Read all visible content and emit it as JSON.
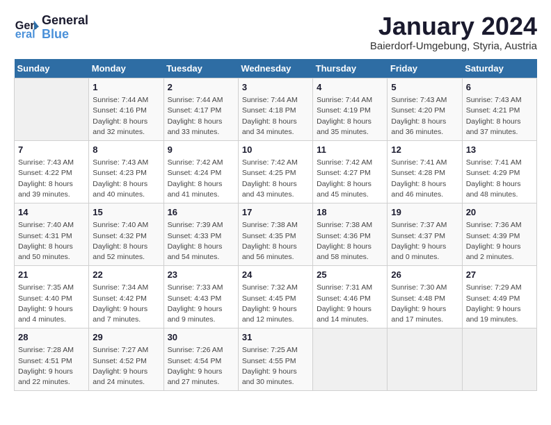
{
  "logo": {
    "line1": "General",
    "line2": "Blue"
  },
  "title": "January 2024",
  "subtitle": "Baierdorf-Umgebung, Styria, Austria",
  "days_of_week": [
    "Sunday",
    "Monday",
    "Tuesday",
    "Wednesday",
    "Thursday",
    "Friday",
    "Saturday"
  ],
  "weeks": [
    [
      {
        "day": "",
        "info": ""
      },
      {
        "day": "1",
        "info": "Sunrise: 7:44 AM\nSunset: 4:16 PM\nDaylight: 8 hours\nand 32 minutes."
      },
      {
        "day": "2",
        "info": "Sunrise: 7:44 AM\nSunset: 4:17 PM\nDaylight: 8 hours\nand 33 minutes."
      },
      {
        "day": "3",
        "info": "Sunrise: 7:44 AM\nSunset: 4:18 PM\nDaylight: 8 hours\nand 34 minutes."
      },
      {
        "day": "4",
        "info": "Sunrise: 7:44 AM\nSunset: 4:19 PM\nDaylight: 8 hours\nand 35 minutes."
      },
      {
        "day": "5",
        "info": "Sunrise: 7:43 AM\nSunset: 4:20 PM\nDaylight: 8 hours\nand 36 minutes."
      },
      {
        "day": "6",
        "info": "Sunrise: 7:43 AM\nSunset: 4:21 PM\nDaylight: 8 hours\nand 37 minutes."
      }
    ],
    [
      {
        "day": "7",
        "info": "Sunrise: 7:43 AM\nSunset: 4:22 PM\nDaylight: 8 hours\nand 39 minutes."
      },
      {
        "day": "8",
        "info": "Sunrise: 7:43 AM\nSunset: 4:23 PM\nDaylight: 8 hours\nand 40 minutes."
      },
      {
        "day": "9",
        "info": "Sunrise: 7:42 AM\nSunset: 4:24 PM\nDaylight: 8 hours\nand 41 minutes."
      },
      {
        "day": "10",
        "info": "Sunrise: 7:42 AM\nSunset: 4:25 PM\nDaylight: 8 hours\nand 43 minutes."
      },
      {
        "day": "11",
        "info": "Sunrise: 7:42 AM\nSunset: 4:27 PM\nDaylight: 8 hours\nand 45 minutes."
      },
      {
        "day": "12",
        "info": "Sunrise: 7:41 AM\nSunset: 4:28 PM\nDaylight: 8 hours\nand 46 minutes."
      },
      {
        "day": "13",
        "info": "Sunrise: 7:41 AM\nSunset: 4:29 PM\nDaylight: 8 hours\nand 48 minutes."
      }
    ],
    [
      {
        "day": "14",
        "info": "Sunrise: 7:40 AM\nSunset: 4:31 PM\nDaylight: 8 hours\nand 50 minutes."
      },
      {
        "day": "15",
        "info": "Sunrise: 7:40 AM\nSunset: 4:32 PM\nDaylight: 8 hours\nand 52 minutes."
      },
      {
        "day": "16",
        "info": "Sunrise: 7:39 AM\nSunset: 4:33 PM\nDaylight: 8 hours\nand 54 minutes."
      },
      {
        "day": "17",
        "info": "Sunrise: 7:38 AM\nSunset: 4:35 PM\nDaylight: 8 hours\nand 56 minutes."
      },
      {
        "day": "18",
        "info": "Sunrise: 7:38 AM\nSunset: 4:36 PM\nDaylight: 8 hours\nand 58 minutes."
      },
      {
        "day": "19",
        "info": "Sunrise: 7:37 AM\nSunset: 4:37 PM\nDaylight: 9 hours\nand 0 minutes."
      },
      {
        "day": "20",
        "info": "Sunrise: 7:36 AM\nSunset: 4:39 PM\nDaylight: 9 hours\nand 2 minutes."
      }
    ],
    [
      {
        "day": "21",
        "info": "Sunrise: 7:35 AM\nSunset: 4:40 PM\nDaylight: 9 hours\nand 4 minutes."
      },
      {
        "day": "22",
        "info": "Sunrise: 7:34 AM\nSunset: 4:42 PM\nDaylight: 9 hours\nand 7 minutes."
      },
      {
        "day": "23",
        "info": "Sunrise: 7:33 AM\nSunset: 4:43 PM\nDaylight: 9 hours\nand 9 minutes."
      },
      {
        "day": "24",
        "info": "Sunrise: 7:32 AM\nSunset: 4:45 PM\nDaylight: 9 hours\nand 12 minutes."
      },
      {
        "day": "25",
        "info": "Sunrise: 7:31 AM\nSunset: 4:46 PM\nDaylight: 9 hours\nand 14 minutes."
      },
      {
        "day": "26",
        "info": "Sunrise: 7:30 AM\nSunset: 4:48 PM\nDaylight: 9 hours\nand 17 minutes."
      },
      {
        "day": "27",
        "info": "Sunrise: 7:29 AM\nSunset: 4:49 PM\nDaylight: 9 hours\nand 19 minutes."
      }
    ],
    [
      {
        "day": "28",
        "info": "Sunrise: 7:28 AM\nSunset: 4:51 PM\nDaylight: 9 hours\nand 22 minutes."
      },
      {
        "day": "29",
        "info": "Sunrise: 7:27 AM\nSunset: 4:52 PM\nDaylight: 9 hours\nand 24 minutes."
      },
      {
        "day": "30",
        "info": "Sunrise: 7:26 AM\nSunset: 4:54 PM\nDaylight: 9 hours\nand 27 minutes."
      },
      {
        "day": "31",
        "info": "Sunrise: 7:25 AM\nSunset: 4:55 PM\nDaylight: 9 hours\nand 30 minutes."
      },
      {
        "day": "",
        "info": ""
      },
      {
        "day": "",
        "info": ""
      },
      {
        "day": "",
        "info": ""
      }
    ]
  ]
}
